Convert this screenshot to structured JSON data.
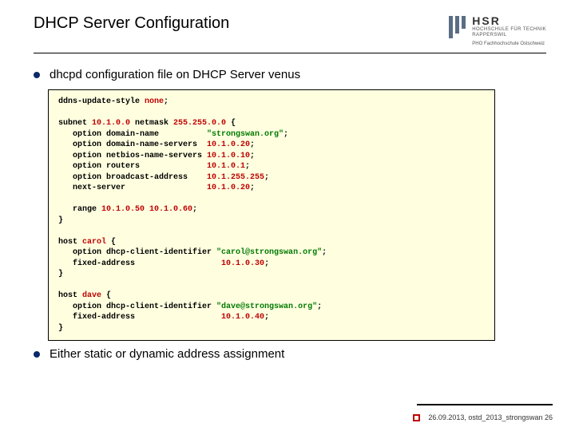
{
  "header": {
    "title": "DHCP Server Configuration",
    "logo": {
      "abbr": "HSR",
      "line1": "HOCHSCHULE FÜR TECHNIK",
      "line2": "RAPPERSWIL",
      "pho": "PHO Fachhochschule Ostschweiz"
    }
  },
  "bullets": {
    "b1": "dhcpd configuration file on DHCP Server venus",
    "b2": "Either static or dynamic address assignment"
  },
  "code": {
    "l01a": "ddns-update-style ",
    "l01b": "none",
    "l01c": ";",
    "blank1": "",
    "l02a": "subnet ",
    "l02b": "10.1.0.0",
    "l02c": " netmask ",
    "l02d": "255.255.0.0",
    "l02e": " {",
    "l03a": "   option domain-name          ",
    "l03b": "\"strongswan.org\"",
    "l03c": ";",
    "l04a": "   option domain-name-servers  ",
    "l04b": "10.1.0.20",
    "l04c": ";",
    "l05a": "   option netbios-name-servers ",
    "l05b": "10.1.0.10",
    "l05c": ";",
    "l06a": "   option routers              ",
    "l06b": "10.1.0.1",
    "l06c": ";",
    "l07a": "   option broadcast-address    ",
    "l07b": "10.1.255.255",
    "l07c": ";",
    "l08a": "   next-server                 ",
    "l08b": "10.1.0.20",
    "l08c": ";",
    "blank2": "",
    "l09a": "   range ",
    "l09b": "10.1.0.50 10.1.0.60",
    "l09c": ";",
    "l10": "}",
    "blank3": "",
    "l11a": "host ",
    "l11b": "carol",
    "l11c": " {",
    "l12a": "   option dhcp-client-identifier ",
    "l12b": "\"carol@strongswan.org\"",
    "l12c": ";",
    "l13a": "   fixed-address                  ",
    "l13b": "10.1.0.30",
    "l13c": ";",
    "l14": "}",
    "blank4": "",
    "l15a": "host ",
    "l15b": "dave",
    "l15c": " {",
    "l16a": "   option dhcp-client-identifier ",
    "l16b": "\"dave@strongswan.org\"",
    "l16c": ";",
    "l17a": "   fixed-address                  ",
    "l17b": "10.1.0.40",
    "l17c": ";",
    "l18": "}"
  },
  "footer": {
    "text": "26.09.2013, ostd_2013_strongswan 26"
  }
}
